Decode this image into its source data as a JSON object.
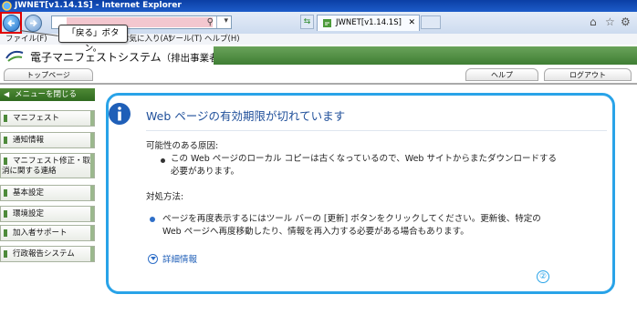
{
  "window": {
    "title": "JWNET[v1.14.1S] - Internet Explorer"
  },
  "browser": {
    "tab_title": "JWNET[v1.14.1S]",
    "menu": [
      "ファイル(F)",
      "編",
      "お気に入り(A)",
      "ツール(T)",
      "ヘルプ(H)"
    ]
  },
  "annotation": {
    "tooltip": "「戻る」ボタン。",
    "step_number": "②"
  },
  "site": {
    "title": "電子マニフェストシステム",
    "subtitle": "（排出事業者）",
    "top_page": "トップページ",
    "help": "ヘルプ",
    "logout": "ログアウト"
  },
  "sidebar": {
    "close_menu": "メニューを閉じる",
    "items": [
      {
        "label": "マニフェスト"
      },
      {
        "label": "通知情報"
      },
      {
        "label_line1": "マニフェスト修正・取",
        "label_line2": "消に関する連絡"
      },
      {
        "label": "基本設定"
      },
      {
        "label": "環境設定"
      },
      {
        "label": "加入者サポート"
      },
      {
        "label": "行政報告システム"
      }
    ]
  },
  "error": {
    "title": "Web ページの有効期限が切れています",
    "cause_heading": "可能性のある原因:",
    "cause_line1": "この Web ページのローカル コピーは古くなっているので、Web サイトからまたダウンロードする",
    "cause_line2": "必要があります。",
    "fix_heading": "対処方法:",
    "fix_line1": "ページを再度表示するにはツール バーの [更新] ボタンをクリックしてください。更新後、特定の",
    "fix_line2": "Web ページへ再度移動したり、情報を再入力する必要がある場合もあります。",
    "more_info": "詳細情報"
  },
  "colors": {
    "panel_border": "#29a3e8",
    "menu_green": "#3f7e34",
    "highlight_red": "#e00000"
  }
}
